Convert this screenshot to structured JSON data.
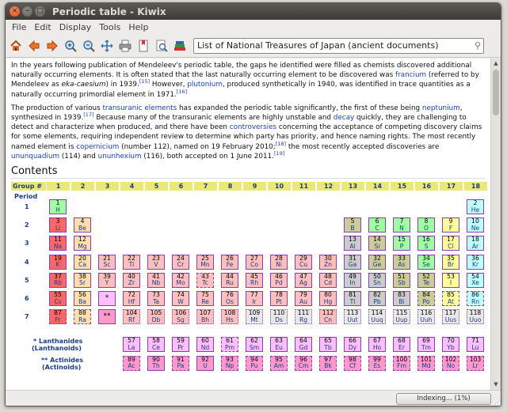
{
  "window": {
    "title": "Periodic table - Kiwix"
  },
  "menu": [
    "File",
    "Edit",
    "Display",
    "Tools",
    "Help"
  ],
  "toolbar": {
    "icons": [
      "home-icon",
      "back-icon",
      "forward-icon",
      "zoom-in-icon",
      "zoom-out-icon",
      "zoom-fit-icon",
      "print-icon",
      "bookmark-icon",
      "find-icon",
      "library-icon"
    ]
  },
  "search": {
    "value": "List of National Treasures of Japan (ancient documents)"
  },
  "article": {
    "p1": {
      "t1": "In the years following publication of Mendeleev's periodic table, the gaps he identified were filled as chemists discovered additional naturally occurring elements. It is often stated that the last naturally occurring element to be discovered was ",
      "l1": "francium",
      "t2": " (referred to by Mendeleev as ",
      "i1": "eka-caesium",
      "t3": ") in 1939.",
      "r1": "[15]",
      "t4": " However, ",
      "l2": "plutonium",
      "t5": ", produced synthetically in 1940, was identified in trace quantities as a naturally occurring primordial element in 1971.",
      "r2": "[16]"
    },
    "p2": {
      "t1": "The production of various ",
      "l1": "transuranic elements",
      "t2": " has expanded the periodic table significantly, the first of these being ",
      "l2": "neptunium",
      "t3": ", synthesized in 1939.",
      "r1": "[17]",
      "t4": " Because many of the transuranic elements are highly unstable and ",
      "l3": "decay",
      "t5": " quickly, they are challenging to detect and characterize when produced, and there have been ",
      "l4": "controversies",
      "t6": " concerning the acceptance of competing discovery claims for some elements, requiring independent review to determine which party has priority, and hence naming rights. The most recently named element is ",
      "l5": "copernicium",
      "t7": " (number 112), named on 19 February 2010;",
      "r2": "[18]",
      "t8": " the most recently accepted discoveries are ",
      "l6": "ununquadium",
      "t9": " (114) and ",
      "l7": "ununhexium",
      "t10": " (116), both accepted on 1 June 2011.",
      "r3": "[19]"
    },
    "contents": "Contents"
  },
  "table": {
    "group_header": "Group #",
    "groups": [
      "1",
      "2",
      "3",
      "4",
      "5",
      "6",
      "7",
      "8",
      "9",
      "10",
      "11",
      "12",
      "13",
      "14",
      "15",
      "16",
      "17",
      "18"
    ],
    "period_label": "Period",
    "periods": [
      "1",
      "2",
      "3",
      "4",
      "5",
      "6",
      "7"
    ],
    "lanthanides": "* Lanthanides",
    "lanthanides2": "(Lanthanoids)",
    "actinides": "** Actinides",
    "actinides2": "(Actinoids)",
    "star1": "*",
    "star2": "**",
    "elements": [
      {
        "n": "1",
        "s": "H",
        "g": 1,
        "p": 1,
        "c": "nm"
      },
      {
        "n": "2",
        "s": "He",
        "g": 18,
        "p": 1,
        "c": "ng"
      },
      {
        "n": "3",
        "s": "Li",
        "g": 1,
        "p": 2,
        "c": "al"
      },
      {
        "n": "4",
        "s": "Be",
        "g": 2,
        "p": 2,
        "c": "ae"
      },
      {
        "n": "5",
        "s": "B",
        "g": 13,
        "p": 2,
        "c": "md"
      },
      {
        "n": "6",
        "s": "C",
        "g": 14,
        "p": 2,
        "c": "nm"
      },
      {
        "n": "7",
        "s": "N",
        "g": 15,
        "p": 2,
        "c": "nm"
      },
      {
        "n": "8",
        "s": "O",
        "g": 16,
        "p": 2,
        "c": "nm"
      },
      {
        "n": "9",
        "s": "F",
        "g": 17,
        "p": 2,
        "c": "hl"
      },
      {
        "n": "10",
        "s": "Ne",
        "g": 18,
        "p": 2,
        "c": "ng"
      },
      {
        "n": "11",
        "s": "Na",
        "g": 1,
        "p": 3,
        "c": "al"
      },
      {
        "n": "12",
        "s": "Mg",
        "g": 2,
        "p": 3,
        "c": "ae"
      },
      {
        "n": "13",
        "s": "Al",
        "g": 13,
        "p": 3,
        "c": "pt"
      },
      {
        "n": "14",
        "s": "Si",
        "g": 14,
        "p": 3,
        "c": "md"
      },
      {
        "n": "15",
        "s": "P",
        "g": 15,
        "p": 3,
        "c": "nm"
      },
      {
        "n": "16",
        "s": "S",
        "g": 16,
        "p": 3,
        "c": "nm"
      },
      {
        "n": "17",
        "s": "Cl",
        "g": 17,
        "p": 3,
        "c": "hl"
      },
      {
        "n": "18",
        "s": "Ar",
        "g": 18,
        "p": 3,
        "c": "ng"
      },
      {
        "n": "19",
        "s": "K",
        "g": 1,
        "p": 4,
        "c": "al"
      },
      {
        "n": "20",
        "s": "Ca",
        "g": 2,
        "p": 4,
        "c": "ae"
      },
      {
        "n": "21",
        "s": "Sc",
        "g": 3,
        "p": 4,
        "c": "tm"
      },
      {
        "n": "22",
        "s": "Ti",
        "g": 4,
        "p": 4,
        "c": "tm"
      },
      {
        "n": "23",
        "s": "V",
        "g": 5,
        "p": 4,
        "c": "tm"
      },
      {
        "n": "24",
        "s": "Cr",
        "g": 6,
        "p": 4,
        "c": "tm"
      },
      {
        "n": "25",
        "s": "Mn",
        "g": 7,
        "p": 4,
        "c": "tm"
      },
      {
        "n": "26",
        "s": "Fe",
        "g": 8,
        "p": 4,
        "c": "tm"
      },
      {
        "n": "27",
        "s": "Co",
        "g": 9,
        "p": 4,
        "c": "tm"
      },
      {
        "n": "28",
        "s": "Ni",
        "g": 10,
        "p": 4,
        "c": "tm"
      },
      {
        "n": "29",
        "s": "Cu",
        "g": 11,
        "p": 4,
        "c": "tm"
      },
      {
        "n": "30",
        "s": "Zn",
        "g": 12,
        "p": 4,
        "c": "tm"
      },
      {
        "n": "31",
        "s": "Ga",
        "g": 13,
        "p": 4,
        "c": "pt"
      },
      {
        "n": "32",
        "s": "Ge",
        "g": 14,
        "p": 4,
        "c": "md"
      },
      {
        "n": "33",
        "s": "As",
        "g": 15,
        "p": 4,
        "c": "md"
      },
      {
        "n": "34",
        "s": "Se",
        "g": 16,
        "p": 4,
        "c": "nm"
      },
      {
        "n": "35",
        "s": "Br",
        "g": 17,
        "p": 4,
        "c": "hl"
      },
      {
        "n": "36",
        "s": "Kr",
        "g": 18,
        "p": 4,
        "c": "ng"
      },
      {
        "n": "37",
        "s": "Rb",
        "g": 1,
        "p": 5,
        "c": "al"
      },
      {
        "n": "38",
        "s": "Sr",
        "g": 2,
        "p": 5,
        "c": "ae"
      },
      {
        "n": "39",
        "s": "Y",
        "g": 3,
        "p": 5,
        "c": "tm"
      },
      {
        "n": "40",
        "s": "Zr",
        "g": 4,
        "p": 5,
        "c": "tm"
      },
      {
        "n": "41",
        "s": "Nb",
        "g": 5,
        "p": 5,
        "c": "tm"
      },
      {
        "n": "42",
        "s": "Mo",
        "g": 6,
        "p": 5,
        "c": "tm"
      },
      {
        "n": "43",
        "s": "Tc",
        "g": 7,
        "p": 5,
        "c": "tm",
        "b": "dash"
      },
      {
        "n": "44",
        "s": "Ru",
        "g": 8,
        "p": 5,
        "c": "tm"
      },
      {
        "n": "45",
        "s": "Rh",
        "g": 9,
        "p": 5,
        "c": "tm"
      },
      {
        "n": "46",
        "s": "Pd",
        "g": 10,
        "p": 5,
        "c": "tm"
      },
      {
        "n": "47",
        "s": "Ag",
        "g": 11,
        "p": 5,
        "c": "tm"
      },
      {
        "n": "48",
        "s": "Cd",
        "g": 12,
        "p": 5,
        "c": "tm"
      },
      {
        "n": "49",
        "s": "In",
        "g": 13,
        "p": 5,
        "c": "pt"
      },
      {
        "n": "50",
        "s": "Sn",
        "g": 14,
        "p": 5,
        "c": "pt"
      },
      {
        "n": "51",
        "s": "Sb",
        "g": 15,
        "p": 5,
        "c": "md"
      },
      {
        "n": "52",
        "s": "Te",
        "g": 16,
        "p": 5,
        "c": "md"
      },
      {
        "n": "53",
        "s": "I",
        "g": 17,
        "p": 5,
        "c": "hl"
      },
      {
        "n": "54",
        "s": "Xe",
        "g": 18,
        "p": 5,
        "c": "ng"
      },
      {
        "n": "55",
        "s": "Cs",
        "g": 1,
        "p": 6,
        "c": "al"
      },
      {
        "n": "56",
        "s": "Ba",
        "g": 2,
        "p": 6,
        "c": "ae"
      },
      {
        "n": "72",
        "s": "Hf",
        "g": 4,
        "p": 6,
        "c": "tm"
      },
      {
        "n": "73",
        "s": "Ta",
        "g": 5,
        "p": 6,
        "c": "tm"
      },
      {
        "n": "74",
        "s": "W",
        "g": 6,
        "p": 6,
        "c": "tm"
      },
      {
        "n": "75",
        "s": "Re",
        "g": 7,
        "p": 6,
        "c": "tm"
      },
      {
        "n": "76",
        "s": "Os",
        "g": 8,
        "p": 6,
        "c": "tm"
      },
      {
        "n": "77",
        "s": "Ir",
        "g": 9,
        "p": 6,
        "c": "tm"
      },
      {
        "n": "78",
        "s": "Pt",
        "g": 10,
        "p": 6,
        "c": "tm"
      },
      {
        "n": "79",
        "s": "Au",
        "g": 11,
        "p": 6,
        "c": "tm"
      },
      {
        "n": "80",
        "s": "Hg",
        "g": 12,
        "p": 6,
        "c": "tm"
      },
      {
        "n": "81",
        "s": "Tl",
        "g": 13,
        "p": 6,
        "c": "pt"
      },
      {
        "n": "82",
        "s": "Pb",
        "g": 14,
        "p": 6,
        "c": "pt"
      },
      {
        "n": "83",
        "s": "Bi",
        "g": 15,
        "p": 6,
        "c": "pt"
      },
      {
        "n": "84",
        "s": "Po",
        "g": 16,
        "p": 6,
        "c": "md",
        "b": "dash"
      },
      {
        "n": "85",
        "s": "At",
        "g": 17,
        "p": 6,
        "c": "hl",
        "b": "dash"
      },
      {
        "n": "86",
        "s": "Rn",
        "g": 18,
        "p": 6,
        "c": "ng",
        "b": "dash"
      },
      {
        "n": "87",
        "s": "Fr",
        "g": 1,
        "p": 7,
        "c": "al",
        "b": "dash"
      },
      {
        "n": "88",
        "s": "Ra",
        "g": 2,
        "p": 7,
        "c": "ae",
        "b": "dash"
      },
      {
        "n": "104",
        "s": "Rf",
        "g": 4,
        "p": 7,
        "c": "tm",
        "b": "dot"
      },
      {
        "n": "105",
        "s": "Db",
        "g": 5,
        "p": 7,
        "c": "tm",
        "b": "dot"
      },
      {
        "n": "106",
        "s": "Sg",
        "g": 6,
        "p": 7,
        "c": "tm",
        "b": "dot"
      },
      {
        "n": "107",
        "s": "Bh",
        "g": 7,
        "p": 7,
        "c": "tm",
        "b": "dot"
      },
      {
        "n": "108",
        "s": "Hs",
        "g": 8,
        "p": 7,
        "c": "tm",
        "b": "dot"
      },
      {
        "n": "109",
        "s": "Mt",
        "g": 9,
        "p": 7,
        "c": "un",
        "b": "dot"
      },
      {
        "n": "110",
        "s": "Ds",
        "g": 10,
        "p": 7,
        "c": "un",
        "b": "dot"
      },
      {
        "n": "111",
        "s": "Rg",
        "g": 11,
        "p": 7,
        "c": "un",
        "b": "dot"
      },
      {
        "n": "112",
        "s": "Cn",
        "g": 12,
        "p": 7,
        "c": "tm",
        "b": "dot"
      },
      {
        "n": "113",
        "s": "Uut",
        "g": 13,
        "p": 7,
        "c": "un",
        "b": "dot"
      },
      {
        "n": "114",
        "s": "Uuq",
        "g": 14,
        "p": 7,
        "c": "un",
        "b": "dot"
      },
      {
        "n": "115",
        "s": "Uup",
        "g": 15,
        "p": 7,
        "c": "un",
        "b": "dot"
      },
      {
        "n": "116",
        "s": "Uuh",
        "g": 16,
        "p": 7,
        "c": "un",
        "b": "dot"
      },
      {
        "n": "117",
        "s": "Uus",
        "g": 17,
        "p": 7,
        "c": "un",
        "b": "dot"
      },
      {
        "n": "118",
        "s": "Uuo",
        "g": 18,
        "p": 7,
        "c": "un",
        "b": "dot"
      }
    ],
    "lanth": [
      [
        "57",
        "La"
      ],
      [
        "58",
        "Ce"
      ],
      [
        "59",
        "Pr"
      ],
      [
        "60",
        "Nd"
      ],
      [
        "61",
        "Pm"
      ],
      [
        "62",
        "Sm"
      ],
      [
        "63",
        "Eu"
      ],
      [
        "64",
        "Gd"
      ],
      [
        "65",
        "Tb"
      ],
      [
        "66",
        "Dy"
      ],
      [
        "67",
        "Ho"
      ],
      [
        "68",
        "Er"
      ],
      [
        "69",
        "Tm"
      ],
      [
        "70",
        "Yb"
      ],
      [
        "71",
        "Lu"
      ]
    ],
    "lanth_dash": [
      "61"
    ],
    "actin": [
      [
        "89",
        "Ac"
      ],
      [
        "90",
        "Th"
      ],
      [
        "91",
        "Pa"
      ],
      [
        "92",
        "U"
      ],
      [
        "93",
        "Np"
      ],
      [
        "94",
        "Pu"
      ],
      [
        "95",
        "Am"
      ],
      [
        "96",
        "Cm"
      ],
      [
        "97",
        "Bk"
      ],
      [
        "98",
        "Cf"
      ],
      [
        "99",
        "Es"
      ],
      [
        "100",
        "Fm"
      ],
      [
        "101",
        "Md"
      ],
      [
        "102",
        "No"
      ],
      [
        "103",
        "Lr"
      ]
    ],
    "actin_dash": [
      "89",
      "91",
      "93",
      "94",
      "95",
      "96",
      "97",
      "98",
      "99",
      "100",
      "101",
      "102",
      "103"
    ]
  },
  "status": {
    "indexing": "Indexing... (1%)"
  }
}
